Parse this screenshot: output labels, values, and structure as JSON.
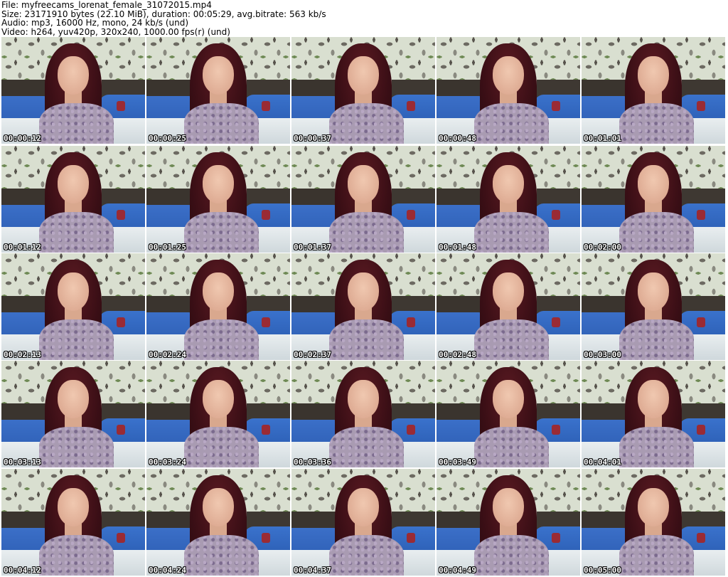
{
  "header": {
    "file_line": "File: myfreecams_lorenat_female_31072015.mp4",
    "size_line": "Size: 23171910 bytes (22.10 MiB), duration: 00:05:29, avg.bitrate: 563 kb/s",
    "audio_line": "Audio: mp3, 16000 Hz, mono, 24 kb/s (und)",
    "video_line": "Video: h264, yuv420p, 320x240, 1000.00 fps(r) (und)"
  },
  "thumbnails": [
    {
      "timestamp": "00:00:12"
    },
    {
      "timestamp": "00:00:25"
    },
    {
      "timestamp": "00:00:37"
    },
    {
      "timestamp": "00:00:48"
    },
    {
      "timestamp": "00:01:01"
    },
    {
      "timestamp": "00:01:12"
    },
    {
      "timestamp": "00:01:25"
    },
    {
      "timestamp": "00:01:37"
    },
    {
      "timestamp": "00:01:48"
    },
    {
      "timestamp": "00:02:00"
    },
    {
      "timestamp": "00:02:13"
    },
    {
      "timestamp": "00:02:24"
    },
    {
      "timestamp": "00:02:37"
    },
    {
      "timestamp": "00:02:48"
    },
    {
      "timestamp": "00:03:00"
    },
    {
      "timestamp": "00:03:13"
    },
    {
      "timestamp": "00:03:24"
    },
    {
      "timestamp": "00:03:36"
    },
    {
      "timestamp": "00:03:49"
    },
    {
      "timestamp": "00:04:01"
    },
    {
      "timestamp": "00:04:12"
    },
    {
      "timestamp": "00:04:24"
    },
    {
      "timestamp": "00:04:37"
    },
    {
      "timestamp": "00:04:49"
    },
    {
      "timestamp": "00:05:00"
    }
  ]
}
